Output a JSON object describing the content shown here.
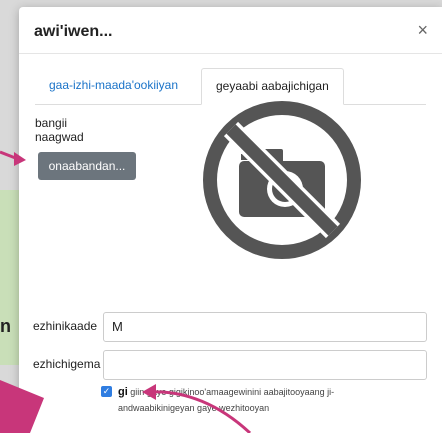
{
  "background": {
    "cut_text": "n"
  },
  "modal": {
    "title": "awi'iwen...",
    "close_symbol": "×",
    "tabs": [
      {
        "label": "gaa-izhi-maada'ookiiyan",
        "active": false
      },
      {
        "label": "geyaabi aabajichigan",
        "active": true
      }
    ],
    "labels": {
      "line1": "bangii",
      "line2": "naagwad"
    },
    "upload_button": "onaabandan...",
    "placeholder_icon": "no-camera-icon",
    "fields": [
      {
        "label": "ezhinikaade",
        "value": "M"
      },
      {
        "label": "ezhichigema",
        "value": ""
      }
    ],
    "checkbox": {
      "checked": true,
      "bold": "gi",
      "text_line1": "giin gaye gigikinoo'amaagewinini aabajitooyaang ji-",
      "text_line2": "andwaabikinigeyan gaye wezhitooyan"
    }
  },
  "colors": {
    "accent": "#2f7de1",
    "link": "#1a73c8",
    "annotation": "#c8367a"
  }
}
